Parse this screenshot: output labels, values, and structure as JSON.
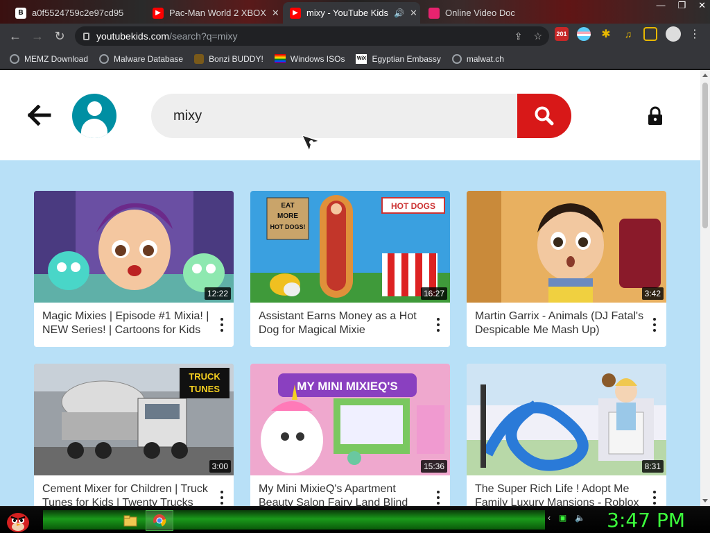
{
  "browser": {
    "tabs": [
      {
        "title": "a0f5524759c2e97cd95",
        "favicon": "b-icon",
        "active": false
      },
      {
        "title": "Pac-Man World 2 XBOX",
        "favicon": "youtube-icon",
        "active": false
      },
      {
        "title": "mixy - YouTube Kids",
        "favicon": "youtube-icon",
        "active": true
      },
      {
        "title": "Online Video Doc",
        "favicon": "pink-icon",
        "active": false
      }
    ],
    "url": {
      "domain": "youtubekids.com",
      "path": "/search?q=mixy"
    },
    "extension_badge": "201",
    "bookmarks": [
      {
        "label": "MEMZ Download",
        "icon": "globe-icon"
      },
      {
        "label": "Malware Database",
        "icon": "globe-icon"
      },
      {
        "label": "Bonzi BUDDY!",
        "icon": "bonzi-icon"
      },
      {
        "label": "Windows ISOs",
        "icon": "rainbow-flag-icon"
      },
      {
        "label": "Egyptian Embassy",
        "icon": "wix-icon"
      },
      {
        "label": "malwat.ch",
        "icon": "globe-icon"
      }
    ]
  },
  "ytkids": {
    "search": {
      "value": "mixy"
    },
    "accent": "#d81818",
    "profile_color": "#008fa3",
    "videos": [
      {
        "title": "Magic Mixies | Episode #1 Mixia! | NEW Series! | Cartoons for Kids",
        "duration": "12:22"
      },
      {
        "title": "Assistant Earns Money as a Hot Dog for Magical Mixie",
        "duration": "16:27"
      },
      {
        "title": "Martin Garrix - Animals (DJ Fatal's Despicable Me Mash Up)",
        "duration": "3:42"
      },
      {
        "title": "Cement Mixer for Children | Truck Tunes for Kids | Twenty Trucks",
        "duration": "3:00"
      },
      {
        "title": "My Mini MixieQ's Apartment Beauty Salon Fairy Land Blind",
        "duration": "15:36"
      },
      {
        "title": "The Super Rich Life ! Adopt Me Family Luxury Mansions - Roblox",
        "duration": "8:31"
      }
    ],
    "thumb_text": {
      "eat_more_hot_dogs": "EAT MORE HOT DOGS!",
      "hot_dogs_sign": "HOT DOGS",
      "truck_tunes": "TRUCK TUNES",
      "my_mini_mixieqs": "MY MINI MIXIEQ'S"
    }
  },
  "taskbar": {
    "clock": "3:47 PM"
  }
}
